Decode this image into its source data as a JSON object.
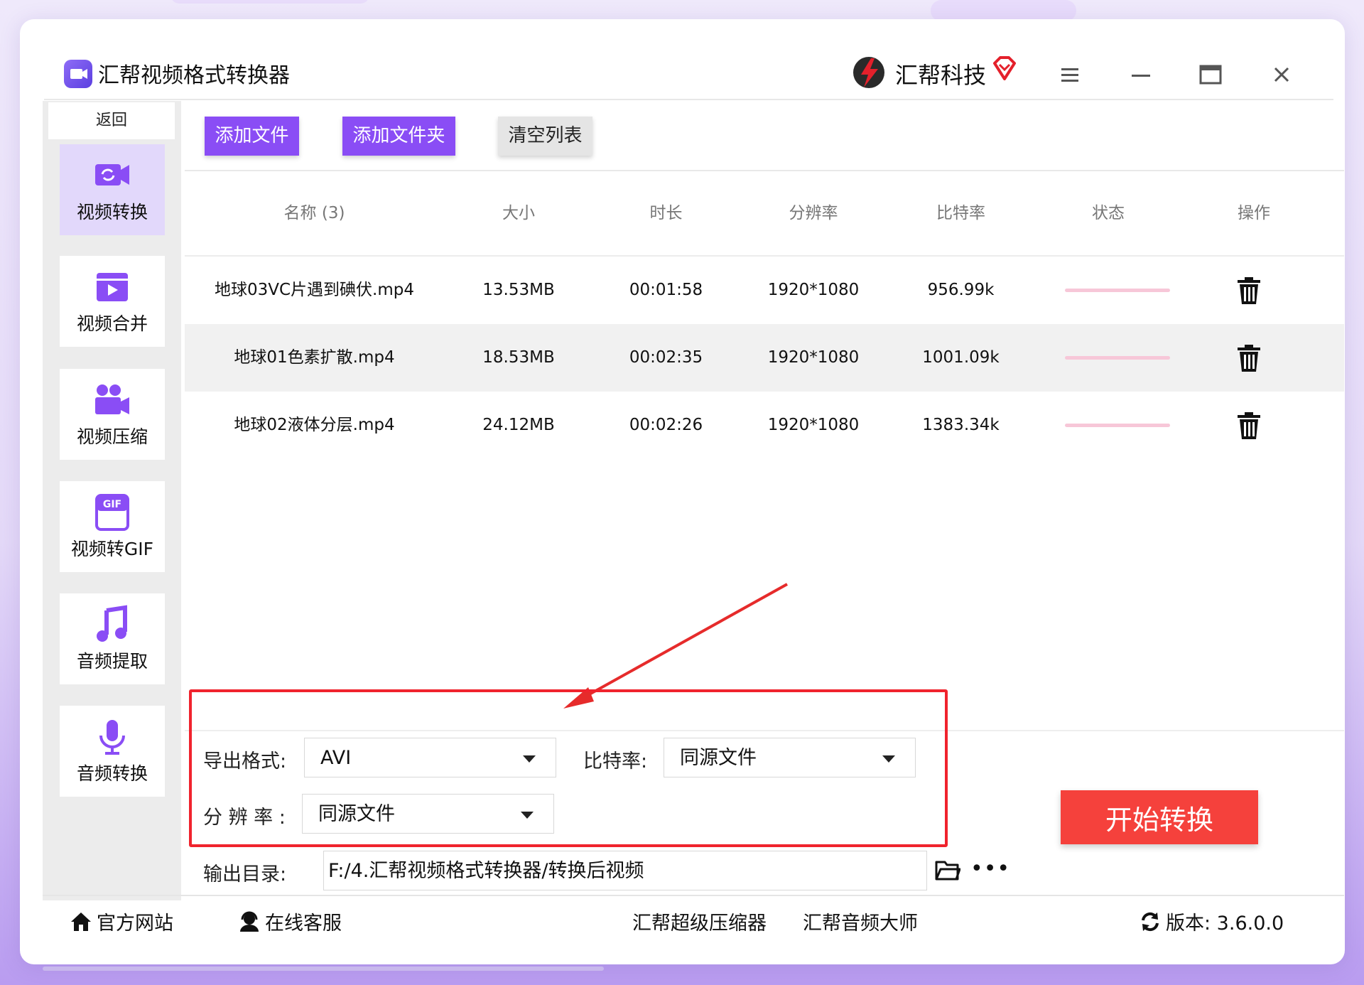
{
  "app": {
    "title": "汇帮视频格式转换器",
    "brand_name": "汇帮科技",
    "accent": "#8a4df5",
    "highlight_color": "#f0232d"
  },
  "sidebar": {
    "back_label": "返回",
    "items": [
      {
        "label": "视频转换",
        "icon": "video-convert-icon",
        "active": true
      },
      {
        "label": "视频合并",
        "icon": "video-merge-icon",
        "active": false
      },
      {
        "label": "视频压缩",
        "icon": "video-compress-icon",
        "active": false
      },
      {
        "label": "视频转GIF",
        "icon": "gif-icon",
        "active": false
      },
      {
        "label": "音频提取",
        "icon": "music-note-icon",
        "active": false
      },
      {
        "label": "音频转换",
        "icon": "microphone-icon",
        "active": false
      }
    ]
  },
  "toolbar": {
    "add_file": "添加文件",
    "add_folder": "添加文件夹",
    "clear_list": "清空列表"
  },
  "table": {
    "headers": [
      "名称 (3)",
      "大小",
      "时长",
      "分辨率",
      "比特率",
      "状态",
      "操作"
    ],
    "rows": [
      {
        "name": "地球03VC片遇到碘伏.mp4",
        "size": "13.53MB",
        "duration": "00:01:58",
        "resolution": "1920*1080",
        "bitrate": "956.99k"
      },
      {
        "name": "地球01色素扩散.mp4",
        "size": "18.53MB",
        "duration": "00:02:35",
        "resolution": "1920*1080",
        "bitrate": "1001.09k"
      },
      {
        "name": "地球02液体分层.mp4",
        "size": "24.12MB",
        "duration": "00:02:26",
        "resolution": "1920*1080",
        "bitrate": "1383.34k"
      }
    ]
  },
  "settings": {
    "format_label": "导出格式:",
    "format_value": "AVI",
    "bitrate_label": "比特率:",
    "bitrate_value": "同源文件",
    "resolution_label": "分 辨 率 :",
    "resolution_value": "同源文件",
    "output_label": "输出目录:",
    "output_value": "F:/4.汇帮视频格式转换器/转换后视频",
    "start_button": "开始转换"
  },
  "footer": {
    "website": "官方网站",
    "support": "在线客服",
    "compressor": "汇帮超级压缩器",
    "audio_master": "汇帮音频大师",
    "version": "版本:  3.6.0.0"
  }
}
